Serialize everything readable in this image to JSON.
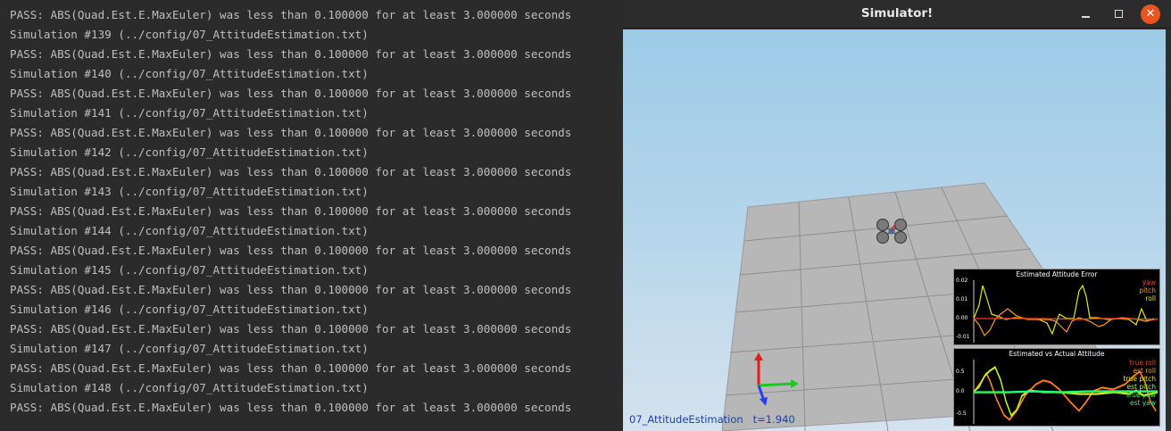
{
  "terminal": {
    "lines": [
      "PASS: ABS(Quad.Est.E.MaxEuler) was less than 0.100000 for at least 3.000000 seconds",
      "Simulation #139 (../config/07_AttitudeEstimation.txt)",
      "PASS: ABS(Quad.Est.E.MaxEuler) was less than 0.100000 for at least 3.000000 seconds",
      "Simulation #140 (../config/07_AttitudeEstimation.txt)",
      "PASS: ABS(Quad.Est.E.MaxEuler) was less than 0.100000 for at least 3.000000 seconds",
      "Simulation #141 (../config/07_AttitudeEstimation.txt)",
      "PASS: ABS(Quad.Est.E.MaxEuler) was less than 0.100000 for at least 3.000000 seconds",
      "Simulation #142 (../config/07_AttitudeEstimation.txt)",
      "PASS: ABS(Quad.Est.E.MaxEuler) was less than 0.100000 for at least 3.000000 seconds",
      "Simulation #143 (../config/07_AttitudeEstimation.txt)",
      "PASS: ABS(Quad.Est.E.MaxEuler) was less than 0.100000 for at least 3.000000 seconds",
      "Simulation #144 (../config/07_AttitudeEstimation.txt)",
      "PASS: ABS(Quad.Est.E.MaxEuler) was less than 0.100000 for at least 3.000000 seconds",
      "Simulation #145 (../config/07_AttitudeEstimation.txt)",
      "PASS: ABS(Quad.Est.E.MaxEuler) was less than 0.100000 for at least 3.000000 seconds",
      "Simulation #146 (../config/07_AttitudeEstimation.txt)",
      "PASS: ABS(Quad.Est.E.MaxEuler) was less than 0.100000 for at least 3.000000 seconds",
      "Simulation #147 (../config/07_AttitudeEstimation.txt)",
      "PASS: ABS(Quad.Est.E.MaxEuler) was less than 0.100000 for at least 3.000000 seconds",
      "Simulation #148 (../config/07_AttitudeEstimation.txt)",
      "PASS: ABS(Quad.Est.E.MaxEuler) was less than 0.100000 for at least 3.000000 seconds"
    ]
  },
  "simulator": {
    "title": "Simulator!",
    "close_glyph": "✕",
    "status": "07_AttitudeEstimation   t=1.940",
    "plot_error": {
      "title": "Estimated Attitude Error",
      "ticks": [
        "0.02",
        "0.01",
        "0.00",
        "-0.01"
      ],
      "legend": [
        {
          "label": "yaw",
          "color": "#ff3a1a"
        },
        {
          "label": "pitch",
          "color": "#ff9a1a"
        },
        {
          "label": "roll",
          "color": "#e6e61a"
        }
      ]
    },
    "plot_attitude": {
      "title": "Estimated vs Actual Attitude",
      "ticks": [
        "0.5",
        "0.0",
        "-0.5"
      ],
      "legend": [
        {
          "label": "true roll",
          "color": "#ff3a1a"
        },
        {
          "label": "est roll",
          "color": "#ff9a1a"
        },
        {
          "label": "true pitch",
          "color": "#e6e61a"
        },
        {
          "label": "est pitch",
          "color": "#b4ff1a"
        },
        {
          "label": "true yaw",
          "color": "#3aff3a"
        },
        {
          "label": "est yaw",
          "color": "#1aff8a"
        }
      ]
    },
    "colors": {
      "sky_top": "#9ccbe7",
      "floor": "#b5b5b5",
      "axis_x": "#1ec81e",
      "axis_y": "#2a3ff0",
      "axis_z": "#e01e1e"
    }
  }
}
